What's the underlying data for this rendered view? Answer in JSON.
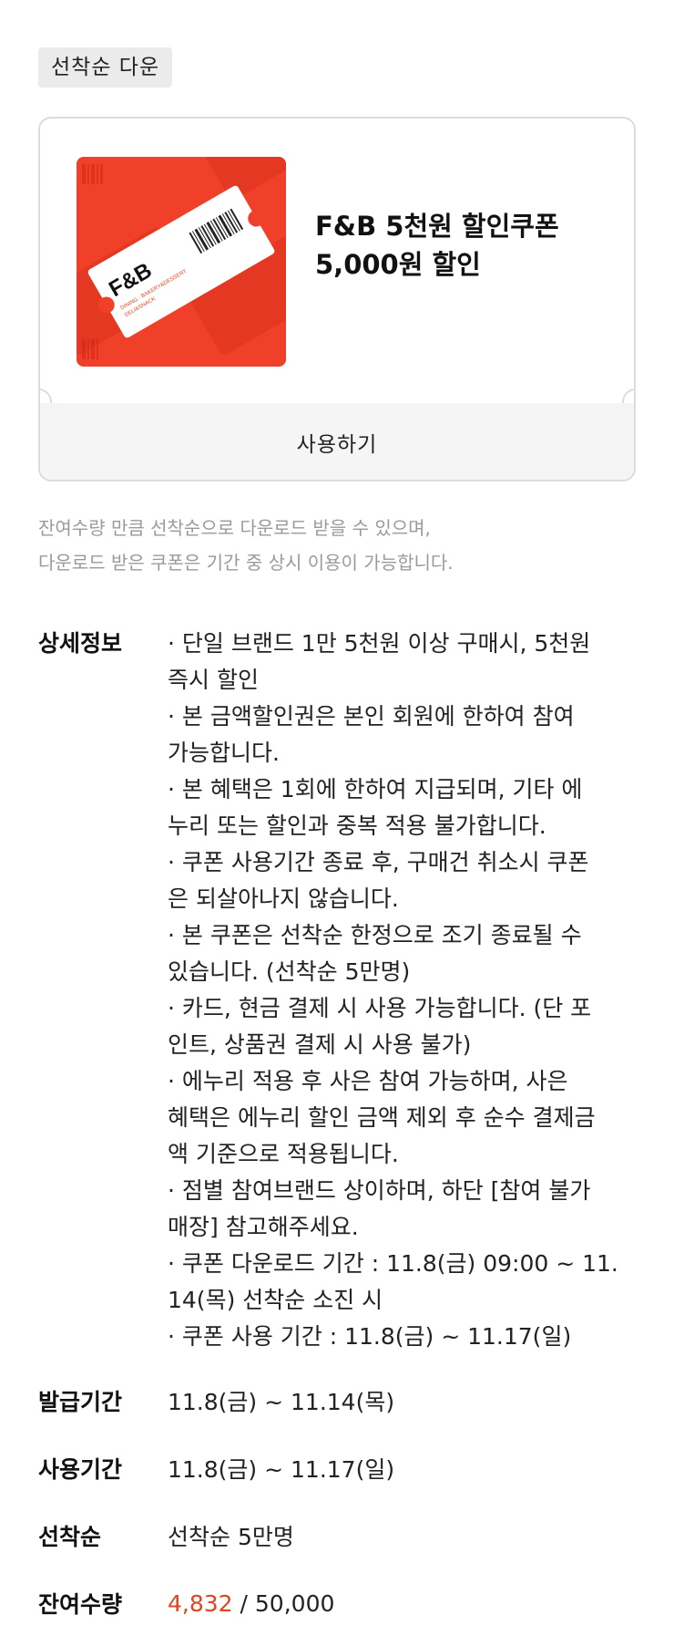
{
  "badge": "선착순 다운",
  "coupon": {
    "title": "F&B 5천원 할인쿠폰",
    "amount": "5,000원 할인",
    "thumb": {
      "logo": "F&B",
      "subtext1": "DINING · BAKERY&DESSERT",
      "subtext2": "DELI&SNACK",
      "bg_color": "#f0402a"
    },
    "use_button": "사용하기"
  },
  "notice": {
    "line1": "잔여수량 만큼 선착순으로 다운로드 받을 수 있으며,",
    "line2": "다운로드 받은 쿠폰은 기간 중 상시 이용이 가능합니다."
  },
  "detail": {
    "label": "상세정보",
    "lines": [
      " · 단일 브랜드 1만 5천원 이상 구매시, 5천원",
      "즉시 할인",
      " · 본 금액할인권은 본인 회원에 한하여 참여",
      "가능합니다.",
      " · 본 혜택은 1회에 한하여 지급되며, 기타 에",
      "누리 또는 할인과 중복 적용 불가합니다.",
      " · 쿠폰 사용기간 종료 후, 구매건 취소시 쿠폰",
      "은 되살아나지 않습니다.",
      " · 본 쿠폰은 선착순 한정으로 조기 종료될 수",
      "있습니다. (선착순 5만명)",
      " · 카드, 현금 결제 시 사용 가능합니다. (단 포",
      "인트, 상품권 결제 시 사용 불가)",
      " · 에누리 적용 후 사은 참여 가능하며, 사은",
      "혜택은 에누리 할인 금액 제외 후 순수 결제금",
      "액 기준으로 적용됩니다.",
      " · 점별 참여브랜드 상이하며, 하단 [참여 불가",
      "매장] 참고해주세요.",
      " · 쿠폰 다운로드 기간 : 11.8(금) 09:00 ~ 11.",
      "14(목) 선착순 소진 시",
      " · 쿠폰 사용 기간 : 11.8(금) ~ 11.17(일)"
    ]
  },
  "issue_period": {
    "label": "발급기간",
    "value": "11.8(금) ~ 11.14(목)"
  },
  "use_period": {
    "label": "사용기간",
    "value": "11.8(금) ~ 11.17(일)"
  },
  "first_come": {
    "label": "선착순",
    "value": "선착순 5만명"
  },
  "remaining": {
    "label": "잔여수량",
    "count": "4,832",
    "separator": " / ",
    "total": "50,000",
    "count_color": "#e0451f"
  }
}
